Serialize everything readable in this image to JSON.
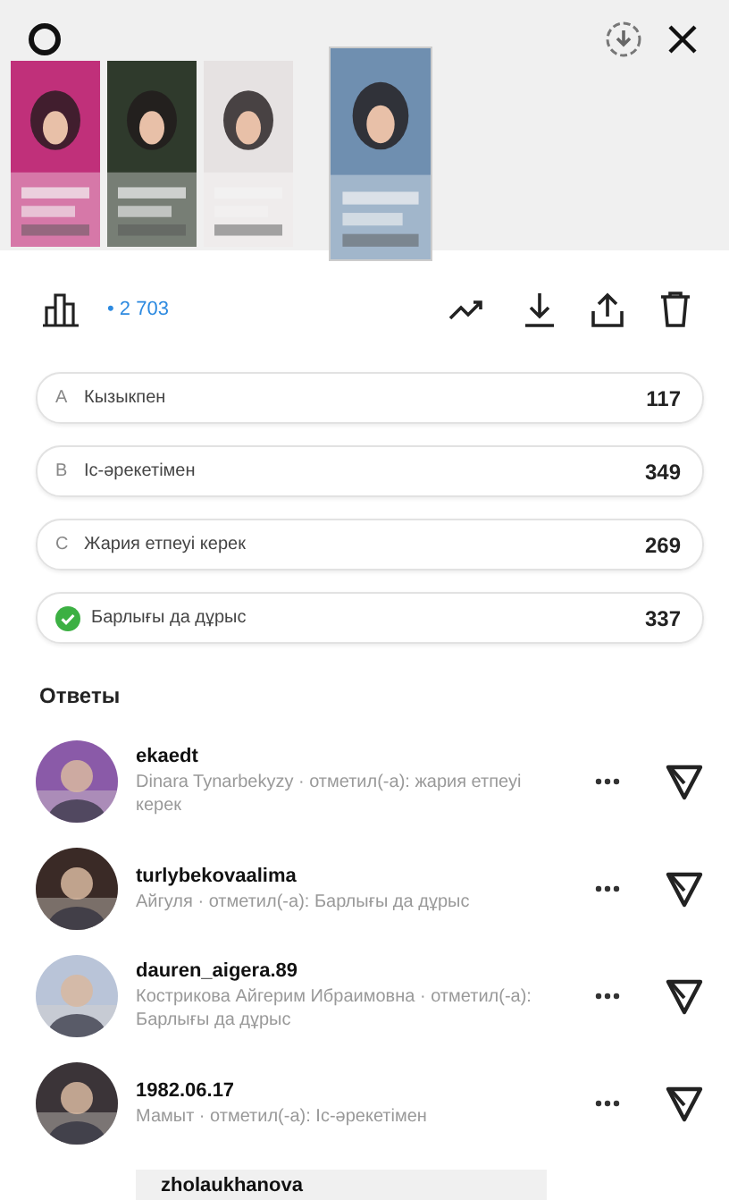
{
  "stories": [
    {
      "kind": "picture",
      "selected": false
    },
    {
      "kind": "picture",
      "selected": false
    },
    {
      "kind": "picture",
      "selected": false
    },
    {
      "kind": "picture",
      "selected": true
    }
  ],
  "stats": {
    "views": "• 2 703"
  },
  "options": [
    {
      "letter": "A",
      "label": "Кызыкпен",
      "count": "117",
      "correct": false
    },
    {
      "letter": "B",
      "label": "Іс-әрекетімен",
      "count": "349",
      "correct": false
    },
    {
      "letter": "C",
      "label": "Жария етпеуі керек",
      "count": "269",
      "correct": false
    },
    {
      "label": "Барлығы да дұрыс",
      "count": "337",
      "correct": true
    }
  ],
  "answers_title": "Ответы",
  "answers": [
    {
      "name": "ekaedt",
      "text": "Dinara Tynarbekyzy · отметил(-а): жария етпеуі керек"
    },
    {
      "name": "turlybekovaalima",
      "text": "Айгуля · отметил(-а): Барлығы да дұрыс"
    },
    {
      "name": "dauren_aigera.89",
      "text": "Кострикова Айгерим Ибраимовна · отметил(-а): Барлығы да дұрыс"
    },
    {
      "name": "1982.06.17",
      "text": "Мамыт · отметил(-а): Іс-әрекетімен"
    },
    {
      "name": "zholaukhanova"
    }
  ]
}
